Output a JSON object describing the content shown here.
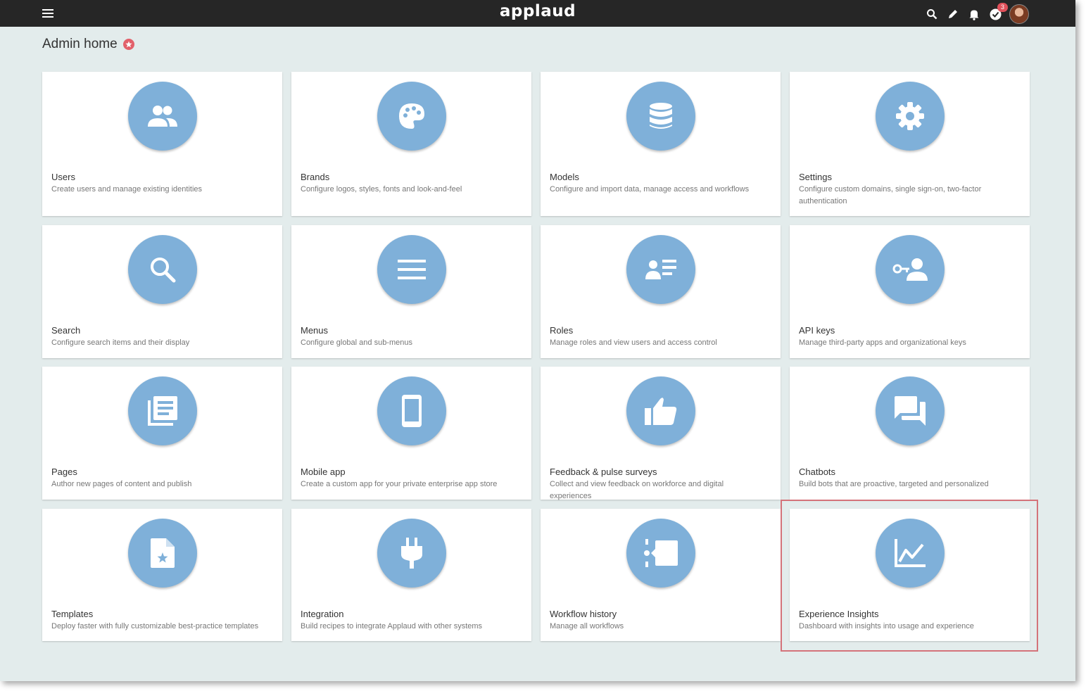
{
  "topbar": {
    "logo": "applaud",
    "tasks_badge": "3"
  },
  "page": {
    "title": "Admin home"
  },
  "cards": [
    {
      "title": "Users",
      "desc": "Create users and manage existing identities",
      "icon": "users-icon"
    },
    {
      "title": "Brands",
      "desc": "Configure logos, styles, fonts and look-and-feel",
      "icon": "palette-icon"
    },
    {
      "title": "Models",
      "desc": "Configure and import data, manage access and workflows",
      "icon": "database-icon"
    },
    {
      "title": "Settings",
      "desc": "Configure custom domains, single sign-on, two-factor authentication",
      "icon": "gear-icon"
    },
    {
      "title": "Search",
      "desc": "Configure search items and their display",
      "icon": "search-icon"
    },
    {
      "title": "Menus",
      "desc": "Configure global and sub-menus",
      "icon": "menu-icon"
    },
    {
      "title": "Roles",
      "desc": "Manage roles and view users and access control",
      "icon": "roles-icon"
    },
    {
      "title": "API keys",
      "desc": "Manage third-party apps and organizational keys",
      "icon": "key-user-icon"
    },
    {
      "title": "Pages",
      "desc": "Author new pages of content and publish",
      "icon": "pages-icon"
    },
    {
      "title": "Mobile app",
      "desc": "Create a custom app for your private enterprise app store",
      "icon": "mobile-icon"
    },
    {
      "title": "Feedback & pulse surveys",
      "desc": "Collect and view feedback on workforce and digital experiences",
      "icon": "thumbs-up-icon"
    },
    {
      "title": "Chatbots",
      "desc": "Build bots that are proactive, targeted and personalized",
      "icon": "chat-icon"
    },
    {
      "title": "Templates",
      "desc": "Deploy faster with fully customizable best-practice templates",
      "icon": "template-icon"
    },
    {
      "title": "Integration",
      "desc": "Build recipes to integrate Applaud with other systems",
      "icon": "plug-icon"
    },
    {
      "title": "Workflow history",
      "desc": "Manage all workflows",
      "icon": "workflow-icon"
    },
    {
      "title": "Experience Insights",
      "desc": "Dashboard with insights into usage and experience",
      "icon": "chart-line-icon"
    }
  ],
  "colors": {
    "topbar": "#262626",
    "background": "#e3ecec",
    "icon_circle": "#7fb0d9",
    "accent": "#e2606a",
    "highlight": "#d4737a"
  }
}
